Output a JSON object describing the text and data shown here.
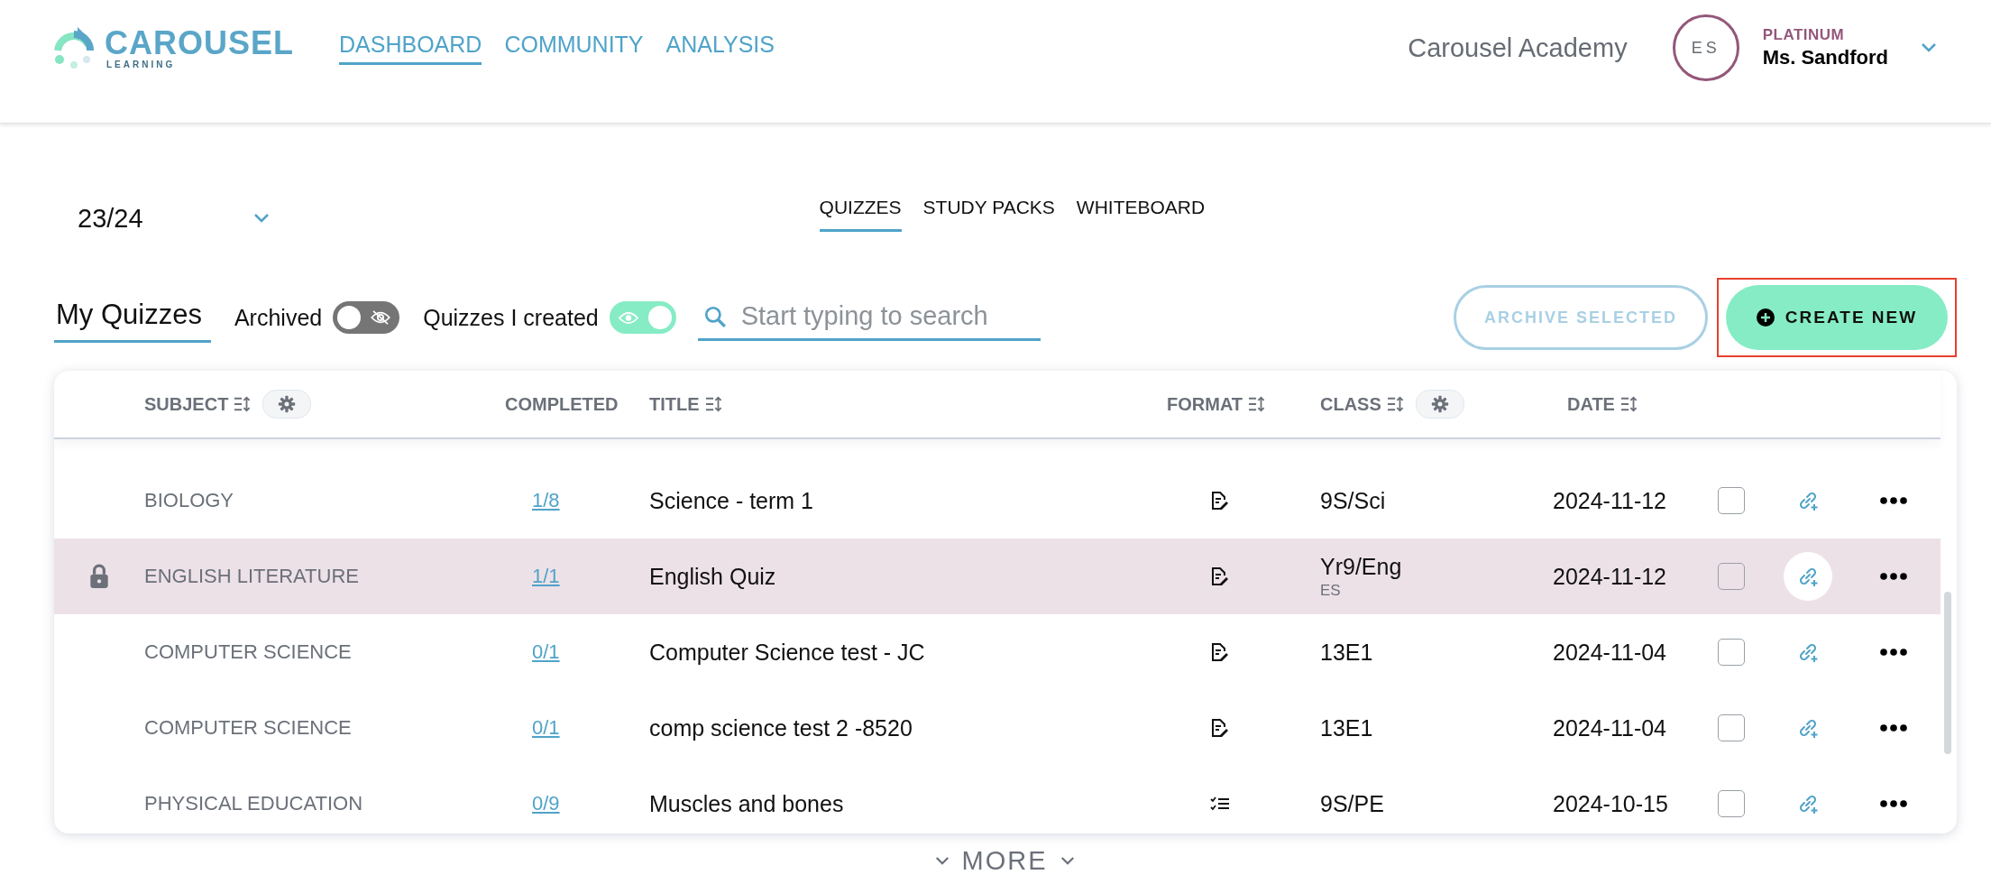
{
  "brand": {
    "name": "CAROUSEL",
    "tagline": "LEARNING"
  },
  "nav": [
    {
      "label": "DASHBOARD",
      "selected": true
    },
    {
      "label": "COMMUNITY",
      "selected": false
    },
    {
      "label": "ANALYSIS",
      "selected": false
    }
  ],
  "school": "Carousel Academy",
  "user": {
    "initials": "ES",
    "tier": "PLATINUM",
    "name": "Ms. Sandford"
  },
  "year_select": {
    "value": "23/24"
  },
  "tabs": [
    {
      "label": "QUIZZES",
      "selected": true
    },
    {
      "label": "STUDY PACKS",
      "selected": false
    },
    {
      "label": "WHITEBOARD",
      "selected": false
    }
  ],
  "section_title": "My Quizzes",
  "toggles": [
    {
      "label": "Archived",
      "on": false
    },
    {
      "label": "Quizzes I created",
      "on": true
    }
  ],
  "search": {
    "placeholder": "Start typing to search"
  },
  "buttons": {
    "archive": {
      "label": "ARCHIVE SELECTED",
      "disabled": true
    },
    "create": {
      "label": "CREATE NEW",
      "highlighted": true
    }
  },
  "table": {
    "columns": [
      {
        "label": "SUBJECT",
        "settings": true
      },
      {
        "label": "COMPLETED",
        "settings": false
      },
      {
        "label": "TITLE",
        "settings": false
      },
      {
        "label": "FORMAT",
        "settings": false
      },
      {
        "label": "CLASS",
        "settings": true
      },
      {
        "label": "DATE",
        "settings": false
      }
    ],
    "rows": [
      {
        "locked": false,
        "selected": false,
        "subject": "BIOLOGY",
        "completed": "1/8",
        "title": "Science - term 1",
        "kind": "written",
        "class": "9S/Sci",
        "date": "2024-11-12",
        "checked": false
      },
      {
        "locked": true,
        "selected": true,
        "subject": "ENGLISH LITERATURE",
        "completed": "1/1",
        "title": "English Quiz",
        "kind": "written",
        "class": "Yr9/Eng",
        "class_note": "ES",
        "date": "2024-11-12",
        "checked": false
      },
      {
        "locked": false,
        "selected": false,
        "subject": "COMPUTER SCIENCE",
        "completed": "0/1",
        "title": "Computer Science test - JC",
        "kind": "written",
        "class": "13E1",
        "date": "2024-11-04",
        "checked": false
      },
      {
        "locked": false,
        "selected": false,
        "subject": "COMPUTER SCIENCE",
        "completed": "0/1",
        "title": "comp science test 2 -8520",
        "kind": "written",
        "class": "13E1",
        "date": "2024-11-04",
        "checked": false
      },
      {
        "locked": false,
        "selected": false,
        "subject": "PHYSICAL EDUCATION",
        "completed": "0/9",
        "title": "Muscles and bones",
        "kind": "checklist",
        "class": "9S/PE",
        "date": "2024-10-15",
        "checked": false
      }
    ]
  },
  "more": "MORE"
}
